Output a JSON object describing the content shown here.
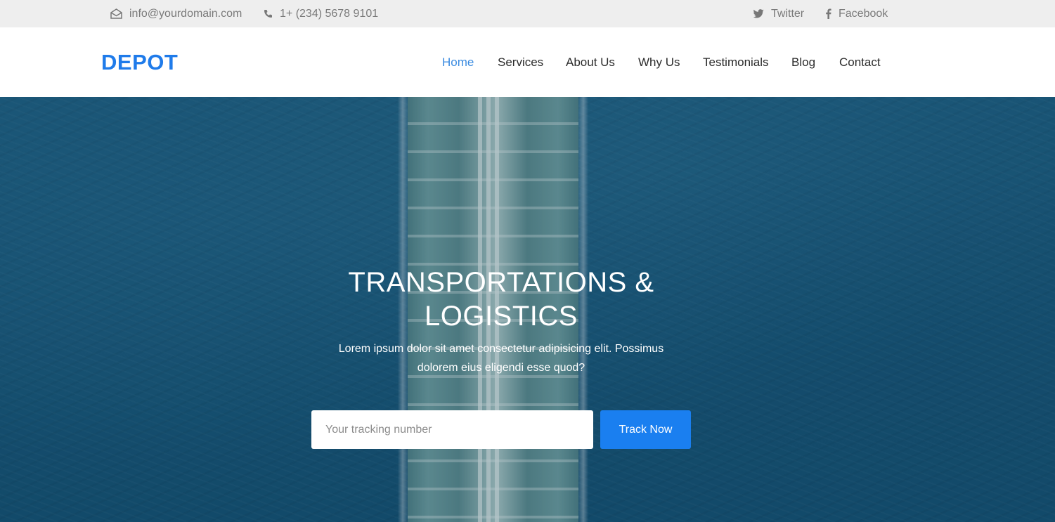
{
  "topbar": {
    "email": "info@yourdomain.com",
    "phone": "1+ (234) 5678 9101",
    "twitter": "Twitter",
    "facebook": "Facebook",
    "icons": {
      "email": "envelope-icon",
      "phone": "phone-icon",
      "twitter": "twitter-icon",
      "facebook": "facebook-icon"
    }
  },
  "header": {
    "logo": "DEPOT",
    "nav": [
      {
        "label": "Home",
        "active": true
      },
      {
        "label": "Services",
        "active": false
      },
      {
        "label": "About Us",
        "active": false
      },
      {
        "label": "Why Us",
        "active": false
      },
      {
        "label": "Testimonials",
        "active": false
      },
      {
        "label": "Blog",
        "active": false
      },
      {
        "label": "Contact",
        "active": false
      }
    ]
  },
  "hero": {
    "title": "TRANSPORTATIONS & LOGISTICS",
    "text": "Lorem ipsum dolor sit amet consectetur adipisicing elit. Possimus dolorem eius eligendi esse quod?",
    "tracking_placeholder": "Your tracking number",
    "tracking_value": "",
    "button_label": "Track Now"
  },
  "colors": {
    "brand": "#1f7bea",
    "nav_active": "#3a8be0",
    "button": "#1a7ff0",
    "topbar_bg": "#eeeeee"
  }
}
